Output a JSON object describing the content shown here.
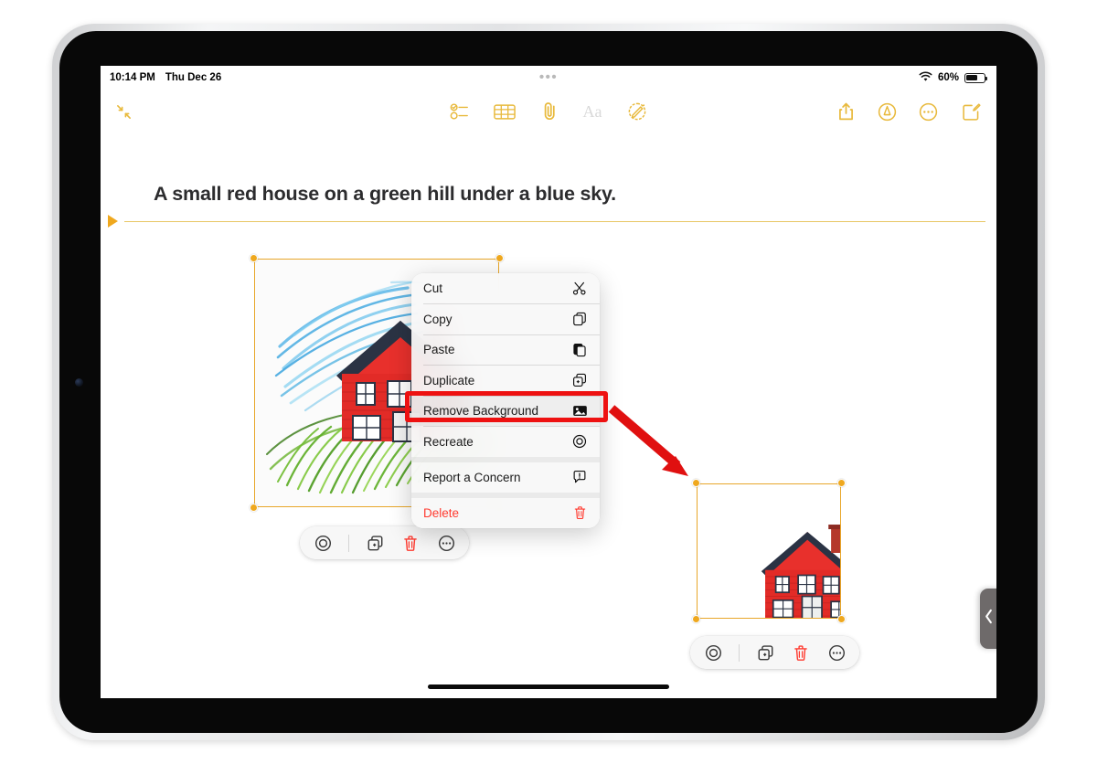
{
  "device": {
    "name": "ipad",
    "orientation": "landscape",
    "frame_color": "#dcdddf",
    "bezel_color": "#080808"
  },
  "status_bar": {
    "time": "10:14 PM",
    "date": "Thu Dec 26",
    "multitask_handle": "•••",
    "wifi_icon": "wifi-icon",
    "battery_percent": "60%",
    "battery_level": 60,
    "battery_icon": "battery-icon"
  },
  "toolbar": {
    "collapse_icon": "collapse-arrows-icon",
    "items": [
      {
        "name": "checklist-icon",
        "label": "Checklist",
        "dim": false
      },
      {
        "name": "table-icon",
        "label": "Table",
        "dim": false
      },
      {
        "name": "attachment-icon",
        "label": "Attach",
        "dim": false
      },
      {
        "name": "text-format-icon",
        "label": "Aa",
        "dim": true
      },
      {
        "name": "markup-magic-icon",
        "label": "Markup",
        "dim": false
      }
    ],
    "right_items": [
      {
        "name": "share-icon",
        "label": "Share"
      },
      {
        "name": "markup-pen-icon",
        "label": "Markup"
      },
      {
        "name": "more-icon",
        "label": "More"
      },
      {
        "name": "compose-icon",
        "label": "New Note"
      }
    ],
    "accent_color": "#e8b93b"
  },
  "note": {
    "title": "A small red house on a green hill under a blue sky.",
    "divider_color": "#e8c766"
  },
  "images": {
    "original": {
      "name": "image-sketch-house-with-background",
      "alt": "Sketch of a red house on a green hill with blue sky strokes",
      "selected": true,
      "handle_color": "#efa81e"
    },
    "result": {
      "name": "image-house-background-removed",
      "alt": "Red house photo with background removed",
      "selected": true,
      "handle_color": "#efa81e"
    }
  },
  "floating_toolbar": {
    "buttons": [
      {
        "name": "recreate-icon",
        "label": "Recreate",
        "danger": false
      },
      {
        "name": "duplicate-icon",
        "label": "Duplicate",
        "danger": false
      },
      {
        "name": "delete-icon",
        "label": "Delete",
        "danger": true
      },
      {
        "name": "more-icon",
        "label": "More",
        "danger": false
      }
    ]
  },
  "context_menu": {
    "items": [
      {
        "label": "Cut",
        "icon": "scissors-icon",
        "destructive": false,
        "highlighted": false,
        "group_break_after": false
      },
      {
        "label": "Copy",
        "icon": "copy-icon",
        "destructive": false,
        "highlighted": false,
        "group_break_after": false
      },
      {
        "label": "Paste",
        "icon": "paste-icon",
        "destructive": false,
        "highlighted": false,
        "group_break_after": false
      },
      {
        "label": "Duplicate",
        "icon": "duplicate-icon",
        "destructive": false,
        "highlighted": false,
        "group_break_after": false
      },
      {
        "label": "Remove Background",
        "icon": "remove-background-icon",
        "destructive": false,
        "highlighted": true,
        "group_break_after": false
      },
      {
        "label": "Recreate",
        "icon": "recreate-icon",
        "destructive": false,
        "highlighted": false,
        "group_break_after": true
      },
      {
        "label": "Report a Concern",
        "icon": "report-concern-icon",
        "destructive": false,
        "highlighted": false,
        "group_break_after": true
      },
      {
        "label": "Delete",
        "icon": "trash-icon",
        "destructive": true,
        "highlighted": false,
        "group_break_after": false
      }
    ]
  },
  "annotation": {
    "highlight_color": "#ee1111",
    "highlight_target": "Remove Background",
    "arrow_color": "#e01010",
    "arrow_direction": "down-right"
  },
  "side_panel": {
    "handle_icon": "chevron-left-icon",
    "handle_color": "#6e6a6a"
  }
}
